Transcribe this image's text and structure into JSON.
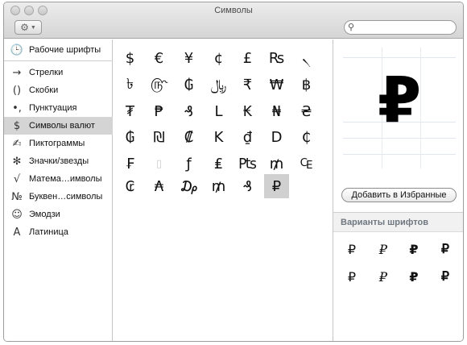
{
  "window": {
    "title": "Символы"
  },
  "toolbar": {
    "gear_menu_icon": "gear-icon",
    "search": {
      "placeholder": "",
      "value": ""
    }
  },
  "sidebar": {
    "items": [
      {
        "icon": "clock-icon",
        "glyph": "🕒",
        "label": "Рабочие шрифты",
        "selected": false
      },
      {
        "icon": "arrow-icon",
        "glyph": "→",
        "label": "Стрелки",
        "selected": false
      },
      {
        "icon": "parentheses-icon",
        "glyph": "()",
        "label": "Скобки",
        "selected": false
      },
      {
        "icon": "punctuation-icon",
        "glyph": "•,",
        "label": "Пунктуация",
        "selected": false
      },
      {
        "icon": "dollar-icon",
        "glyph": "$",
        "label": "Символы валют",
        "selected": true
      },
      {
        "icon": "pencil-icon",
        "glyph": "✍",
        "label": "Пиктограммы",
        "selected": false
      },
      {
        "icon": "asterisk-icon",
        "glyph": "✻",
        "label": "Значки/звезды",
        "selected": false
      },
      {
        "icon": "sqrt-icon",
        "glyph": "√",
        "label": "Матема…имволы",
        "selected": false
      },
      {
        "icon": "numero-icon",
        "glyph": "№",
        "label": "Буквен…символы",
        "selected": false
      },
      {
        "icon": "smiley-icon",
        "glyph": "☺",
        "label": "Эмодзи",
        "selected": false
      },
      {
        "icon": "latin-a-icon",
        "glyph": "A",
        "label": "Латиница",
        "selected": false
      }
    ]
  },
  "grid": {
    "rows": [
      [
        "$",
        "€",
        "¥",
        "¢",
        "£",
        "₨",
        "৲"
      ],
      [
        "৳",
        "௹",
        "₲",
        "﷼",
        "₹",
        "₩",
        "฿"
      ],
      [
        "₮",
        "₱",
        "₰",
        "L",
        "₭",
        "₦",
        "₴"
      ],
      [
        "₲",
        "₪",
        "₡",
        "K",
        "₫",
        "D",
        "₵"
      ],
      [
        "₣",
        "",
        "ƒ",
        "₤",
        "₧",
        "₥",
        "₠"
      ],
      [
        "₢",
        "₳",
        "₯",
        "₥",
        "₰",
        "₽"
      ]
    ],
    "selected": {
      "row": 5,
      "col": 5
    }
  },
  "detail": {
    "preview_glyph": "₽",
    "add_favorites_label": "Добавить в Избранные",
    "font_variants_title": "Варианты шрифтов",
    "variants": [
      "₽",
      "₽",
      "₽",
      "₽",
      "₽",
      "₽",
      "₽",
      "₽"
    ]
  }
}
